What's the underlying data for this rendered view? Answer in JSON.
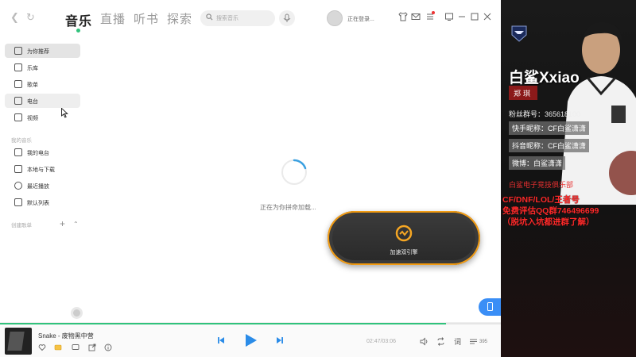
{
  "header": {
    "tabs": [
      {
        "label": "音乐"
      },
      {
        "label": "直播"
      },
      {
        "label": "听书"
      },
      {
        "label": "探索"
      }
    ],
    "search_placeholder": "搜索音乐",
    "login_text": "正在登录..."
  },
  "sidebar": {
    "items": [
      {
        "label": "为你推荐"
      },
      {
        "label": "乐库"
      },
      {
        "label": "歌单"
      },
      {
        "label": "电台"
      },
      {
        "label": "视频"
      }
    ],
    "my_music_title": "我的音乐",
    "my_music_items": [
      {
        "label": "我的电台"
      },
      {
        "label": "本地与下载"
      },
      {
        "label": "最近播放"
      },
      {
        "label": "默认列表"
      }
    ],
    "created_playlists_title": "创建歌单"
  },
  "main": {
    "loading_text": "正在为你拼命加载...",
    "accelerator_label": "加速双引擎"
  },
  "player": {
    "song_title": "Snake - 废物黑中营",
    "time": "02:47/03:06",
    "lyrics_label": "词",
    "playlist_count": "395",
    "progress_fraction": 0.89
  },
  "stream_overlay": {
    "streamer_name": "白鲨Xxiao",
    "real_name": "郑琪",
    "fan_group": "粉丝群号：365618100",
    "kuaishou": "快手昵称：CF白鲨潇潇",
    "douyin": "抖音昵称：CF白鲨潇潇",
    "weibo": "微博：白鲨潇潇",
    "club": "白鲨电子竞技俱乐部",
    "promo_line1": "CF/DNF/LOL/王者号",
    "promo_line2": "免费评估QQ群746496699",
    "promo_line3": "（脱坑入坑都进群了解）"
  },
  "colors": {
    "accent_green": "#31c27c",
    "accel_orange": "#f39c12",
    "promo_red": "#ff2a2a",
    "float_blue": "#3a8ef6"
  }
}
